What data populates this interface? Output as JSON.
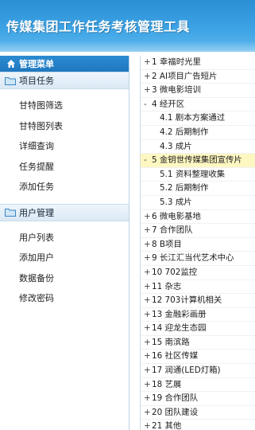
{
  "header": {
    "title": "传媒集团工作任务考核管理工具"
  },
  "sidebar": {
    "menu_title": "管理菜单",
    "groups": [
      {
        "title": "项目任务",
        "items": [
          "甘特图筛选",
          "甘特图列表",
          "详细查询",
          "任务提醒",
          "添加任务"
        ]
      },
      {
        "title": "用户管理",
        "items": [
          "用户列表",
          "添加用户",
          "数据备份",
          "修改密码"
        ]
      }
    ]
  },
  "tree": {
    "rows": [
      {
        "mark": "+",
        "label": "1 幸福时光里",
        "level": 0
      },
      {
        "mark": "+",
        "label": "2 AI项目广告短片",
        "level": 0
      },
      {
        "mark": "+",
        "label": "3 微电影培训",
        "level": 0
      },
      {
        "mark": "-",
        "label": "4 经开区",
        "level": 0
      },
      {
        "mark": "",
        "label": "4.1 剧本方案通过",
        "level": 1
      },
      {
        "mark": "",
        "label": "4.2 后期制作",
        "level": 1
      },
      {
        "mark": "",
        "label": "4.3 成片",
        "level": 1
      },
      {
        "mark": "-",
        "label": "5 金钥世传媒集团宣传片",
        "level": 0,
        "highlight": true
      },
      {
        "mark": "",
        "label": "5.1 资料整理收集",
        "level": 1
      },
      {
        "mark": "",
        "label": "5.2 后期制作",
        "level": 1
      },
      {
        "mark": "",
        "label": "5.3 成片",
        "level": 1
      },
      {
        "mark": "+",
        "label": "6 微电影基地",
        "level": 0
      },
      {
        "mark": "+",
        "label": "7 合作团队",
        "level": 0
      },
      {
        "mark": "+",
        "label": "8 B项目",
        "level": 0
      },
      {
        "mark": "+",
        "label": "9 长江汇当代艺术中心",
        "level": 0
      },
      {
        "mark": "+",
        "label": "10 702监控",
        "level": 0
      },
      {
        "mark": "+",
        "label": "11 杂志",
        "level": 0
      },
      {
        "mark": "+",
        "label": "12 703计算机相关",
        "level": 0
      },
      {
        "mark": "+",
        "label": "13 金融彩画册",
        "level": 0
      },
      {
        "mark": "+",
        "label": "14 迎龙生态园",
        "level": 0
      },
      {
        "mark": "+",
        "label": "15 南滨路",
        "level": 0
      },
      {
        "mark": "+",
        "label": "16 社区传媒",
        "level": 0
      },
      {
        "mark": "+",
        "label": "17 润通(LED灯箱)",
        "level": 0
      },
      {
        "mark": "+",
        "label": "18 艺展",
        "level": 0
      },
      {
        "mark": "+",
        "label": "19 合作团队",
        "level": 0
      },
      {
        "mark": "+",
        "label": "20 团队建设",
        "level": 0
      },
      {
        "mark": "+",
        "label": "21 其他",
        "level": 0
      }
    ]
  },
  "colors": {
    "header": "#3da3e5",
    "menu_head": "#2d8bd1",
    "highlight": "#fff7c2"
  },
  "icons": {
    "menu": "home-icon",
    "group": "folder-icon"
  }
}
